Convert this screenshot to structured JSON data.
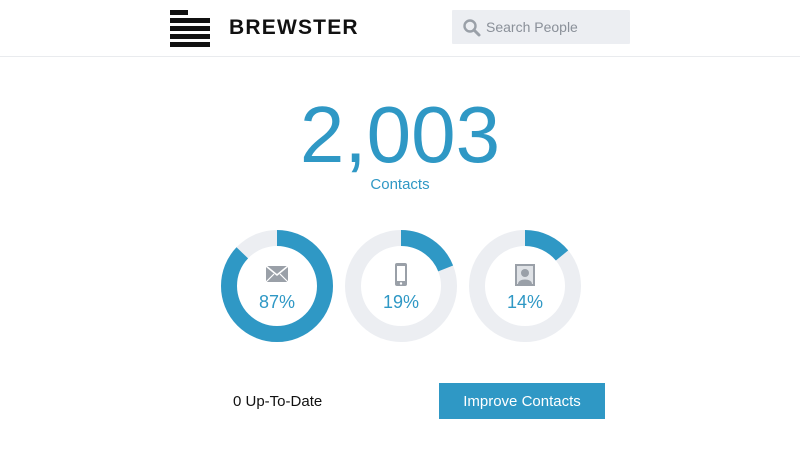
{
  "header": {
    "brand": "BREWSTER",
    "search": {
      "placeholder": "Search People",
      "value": "",
      "icon": "search-icon"
    }
  },
  "summary": {
    "count": "2,003",
    "label": "Contacts"
  },
  "stats": [
    {
      "name": "email",
      "icon": "envelope-icon",
      "percent": 87,
      "percent_label": "87%"
    },
    {
      "name": "phone",
      "icon": "phone-icon",
      "percent": 19,
      "percent_label": "19%"
    },
    {
      "name": "photo",
      "icon": "person-photo-icon",
      "percent": 14,
      "percent_label": "14%"
    }
  ],
  "footer": {
    "status": "0 Up-To-Date",
    "button_label": "Improve Contacts"
  },
  "colors": {
    "accent": "#2f98c5",
    "track": "#eceef2",
    "icon_gray": "#9aa0a8"
  }
}
